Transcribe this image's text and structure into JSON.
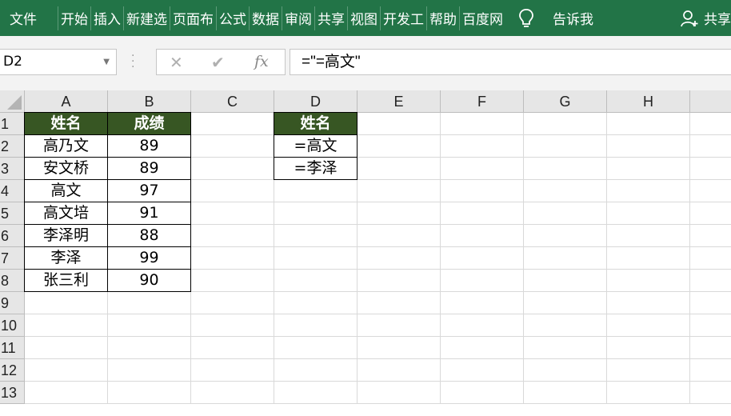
{
  "ribbon": {
    "tabs": [
      "文件",
      "开始",
      "插入",
      "新建选",
      "页面布",
      "公式",
      "数据",
      "审阅",
      "共享",
      "视图",
      "开发工",
      "帮助",
      "百度网"
    ],
    "tell_me": "告诉我",
    "share": "共享"
  },
  "name_box": {
    "value": "D2"
  },
  "formula_bar": {
    "value": "=\"=高文\""
  },
  "columns": [
    "A",
    "B",
    "C",
    "D",
    "E",
    "F",
    "G",
    "H"
  ],
  "rows": [
    "1",
    "2",
    "3",
    "4",
    "5",
    "6",
    "7",
    "8",
    "9",
    "10",
    "11",
    "12",
    "13"
  ],
  "table": {
    "headers": [
      "姓名",
      "成绩"
    ],
    "rows": [
      [
        "高乃文",
        "89"
      ],
      [
        "安文桥",
        "89"
      ],
      [
        "高文",
        "97"
      ],
      [
        "高文培",
        "91"
      ],
      [
        "李泽明",
        "88"
      ],
      [
        "李泽",
        "99"
      ],
      [
        "张三利",
        "90"
      ]
    ]
  },
  "criteria": {
    "header": "姓名",
    "values": [
      "=高文",
      "=李泽"
    ]
  },
  "colors": {
    "ribbon": "#227447",
    "table_header": "#375623"
  }
}
